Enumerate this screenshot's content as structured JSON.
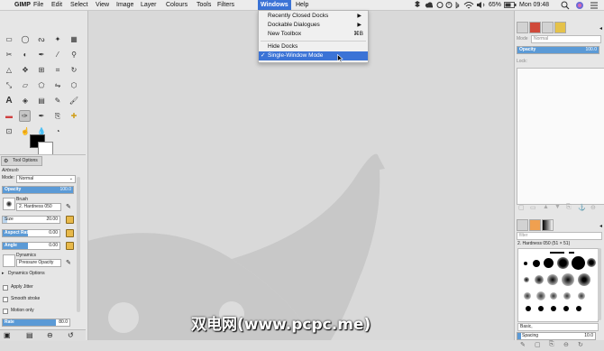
{
  "menubar": {
    "app_name": "GIMP",
    "items": [
      "File",
      "Edit",
      "Select",
      "View",
      "Image",
      "Layer",
      "Colours",
      "Tools",
      "Filters",
      "Windows",
      "Help"
    ],
    "battery": "65%",
    "clock": "Mon 09:48"
  },
  "windows_menu": {
    "items": [
      {
        "label": "Recently Closed Docks",
        "submenu": true
      },
      {
        "label": "Dockable Dialogues",
        "submenu": true
      },
      {
        "label": "New Toolbox",
        "shortcut": "⌘B"
      },
      {
        "label": "Hide Docks"
      },
      {
        "label": "Single-Window Mode",
        "checked": true,
        "check_mark": "✓"
      }
    ]
  },
  "tool_options": {
    "tab_label": "Tool Options",
    "tool_name": "Airbrush",
    "mode_label": "Mode:",
    "mode_value": "Normal",
    "opacity_label": "Opacity",
    "opacity_value": "100.0",
    "opacity_fraction": 1.0,
    "brush_label": "Brush",
    "brush_name": "2. Hardness 050",
    "size_label": "Size",
    "size_value": "20.00",
    "aspect_label": "Aspect Ratio",
    "aspect_value": "0.00",
    "angle_label": "Angle",
    "angle_value": "0.00",
    "dynamics_label": "Dynamics",
    "dynamics_value": "Pressure Opacity",
    "dynamics_options": "Dynamics Options",
    "apply_jitter": "Apply Jitter",
    "smooth_stroke": "Smooth stroke",
    "motion_only": "Motion only",
    "rate_label": "Rate",
    "rate_value": "80.0"
  },
  "layers_panel": {
    "mode_label": "Mode",
    "mode_value": "Normal",
    "opacity_label": "Opacity",
    "opacity_value": "100.0",
    "lock_label": "Lock:"
  },
  "brushes_panel": {
    "filter_placeholder": "filter",
    "brush_title": "2. Hardness 050 (51 × 51)",
    "tag_value": "Basic,",
    "spacing_label": "Spacing",
    "spacing_value": "10.0"
  },
  "watermark": "双电网(www.pcpc.me)",
  "colors": {
    "accent": "#3b73d6",
    "slider_fill": "#5b9ad6",
    "foreground": "#000000",
    "background": "#ffffff"
  }
}
